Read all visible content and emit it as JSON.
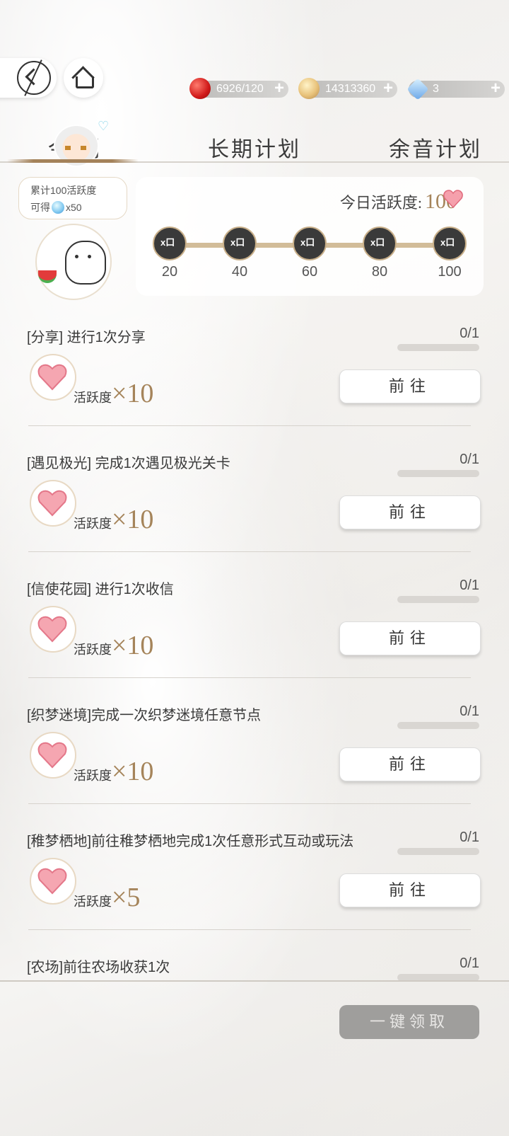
{
  "resources": {
    "apple": "6926/120",
    "coin": "14313360",
    "gem": "3",
    "plus": "+"
  },
  "tabs": {
    "daily": "今日计划",
    "daily_visible": "今    划",
    "long": "长期计划",
    "echo": "余音计划"
  },
  "accumulate": {
    "line1": "累计100活跃度",
    "line2_prefix": "可得",
    "line2_suffix": "x50"
  },
  "activity": {
    "label": "今日活跃度:",
    "value": "100",
    "milestones": [
      "20",
      "40",
      "60",
      "80",
      "100"
    ],
    "milestone_icon_text": "x口"
  },
  "tasks": [
    {
      "title": "[分享] 进行1次分享",
      "progress": "0/1",
      "reward_label": "活跃度",
      "reward_x": "×10",
      "button": "前往"
    },
    {
      "title": "[遇见极光] 完成1次遇见极光关卡",
      "progress": "0/1",
      "reward_label": "活跃度",
      "reward_x": "×10",
      "button": "前往"
    },
    {
      "title": "[信使花园] 进行1次收信",
      "progress": "0/1",
      "reward_label": "活跃度",
      "reward_x": "×10",
      "button": "前往"
    },
    {
      "title": "[织梦迷境]完成一次织梦迷境任意节点",
      "progress": "0/1",
      "reward_label": "活跃度",
      "reward_x": "×10",
      "button": "前往"
    },
    {
      "title": "[稚梦栖地]前往稚梦栖地完成1次任意形式互动或玩法",
      "progress": "0/1",
      "reward_label": "活跃度",
      "reward_x": "×5",
      "button": "前往"
    },
    {
      "title": "[农场]前往农场收获1次",
      "progress": "0/1"
    }
  ],
  "claim_all": "一键领取",
  "colors": {
    "accent_gold": "#a5845a",
    "heart_pink": "#f27a8c"
  }
}
